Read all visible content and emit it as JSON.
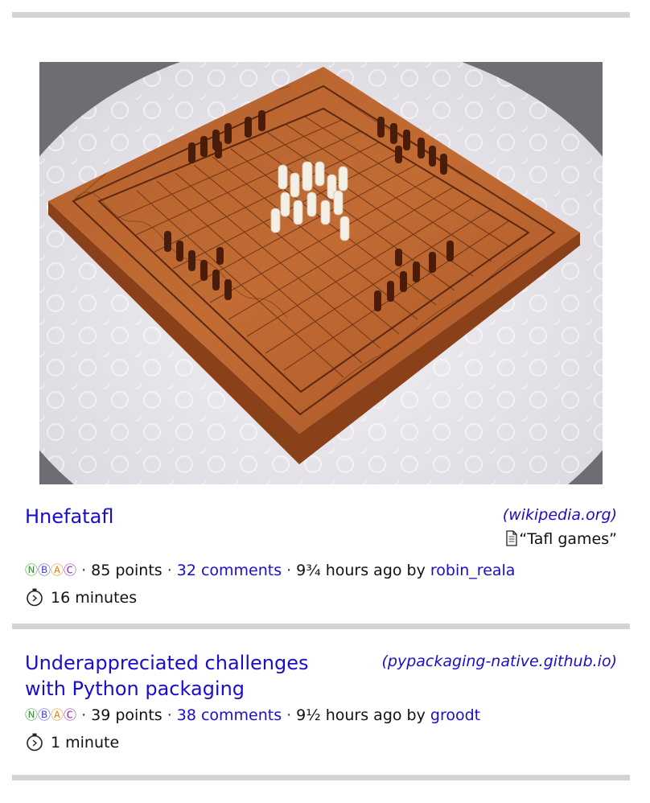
{
  "stories": [
    {
      "title": "Hnefatafl",
      "domain": "(wikipedia.org)",
      "tag": "“Tafl games”",
      "badges": [
        "Ⓝ",
        "Ⓑ",
        "Ⓐ",
        "Ⓒ"
      ],
      "points": "85 points",
      "comments": "32 comments",
      "time_by": "9¾ hours ago by",
      "user": "robin_reala",
      "read_time": "16 minutes",
      "thumbnail_icon": "hnefatafl-board-image"
    },
    {
      "title_line1": "Underappreciated challenges",
      "title_line2": "with Python packaging",
      "domain": "(pypackaging-native.github.io)",
      "badges": [
        "Ⓝ",
        "Ⓑ",
        "Ⓐ",
        "Ⓒ"
      ],
      "points": "39 points",
      "comments": "38 comments",
      "time_by": "9½ hours ago by",
      "user": "groodt",
      "read_time": "1 minute"
    }
  ],
  "icons": {
    "document": "document-icon",
    "stopwatch": "stopwatch-icon"
  },
  "colors": {
    "link": "#1a0dcc",
    "divider": "#d3d3d3",
    "badge_n": "#2b9a2b",
    "badge_b": "#4848d8",
    "badge_a": "#e08a1a",
    "badge_c": "#8a2ab8"
  }
}
